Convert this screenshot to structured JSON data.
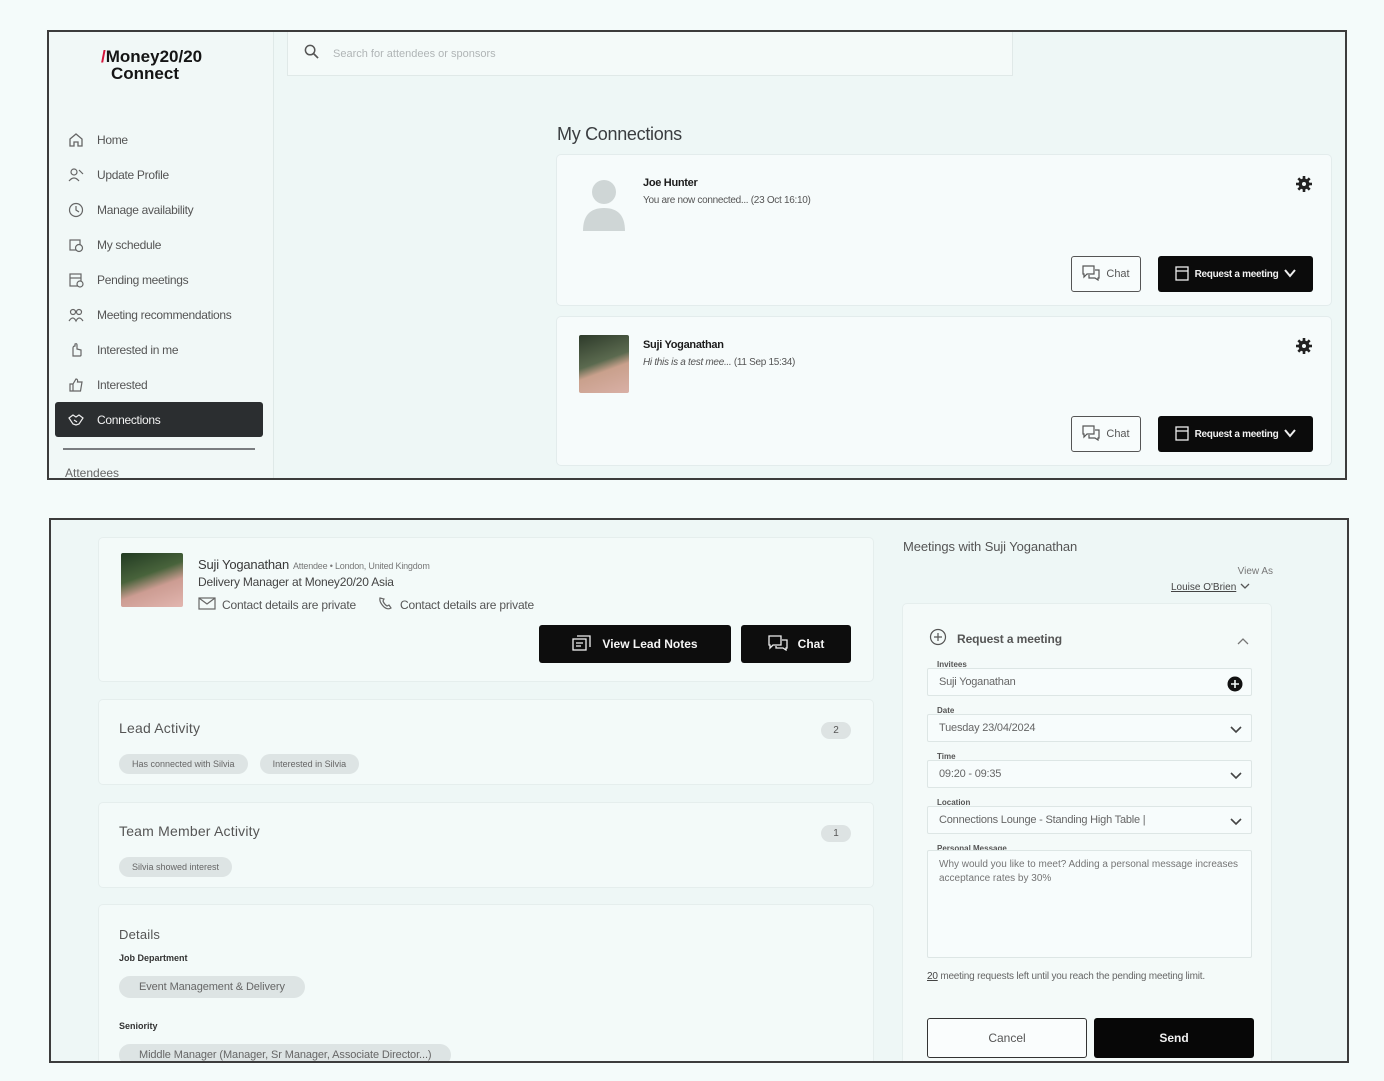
{
  "app": {
    "logo_line1": "Money20/20",
    "logo_line2": "Connect"
  },
  "search": {
    "placeholder": "Search for attendees or sponsors"
  },
  "sidebar": {
    "items": [
      {
        "label": "Home",
        "icon": "home-icon"
      },
      {
        "label": "Update Profile",
        "icon": "update-profile-icon"
      },
      {
        "label": "Manage availability",
        "icon": "clock-icon"
      },
      {
        "label": "My schedule",
        "icon": "schedule-icon"
      },
      {
        "label": "Pending meetings",
        "icon": "pending-calendar-icon"
      },
      {
        "label": "Meeting recommendations",
        "icon": "people-icon"
      },
      {
        "label": "Interested in me",
        "icon": "hand-icon"
      },
      {
        "label": "Interested",
        "icon": "thumbs-up-icon"
      },
      {
        "label": "Connections",
        "icon": "handshake-icon"
      }
    ],
    "section": "Attendees"
  },
  "connections": {
    "title": "My Connections",
    "items": [
      {
        "name": "Joe Hunter",
        "message": "You are now connected...",
        "time": "(23 Oct 16:10)"
      },
      {
        "name": "Suji Yoganathan",
        "message": "Hi this is a test mee...",
        "time": "(11 Sep 15:34)"
      }
    ],
    "chat_label": "Chat",
    "request_label": "Request a meeting"
  },
  "profile": {
    "name": "Suji Yoganathan",
    "meta": "Attendee • London, United Kingdom",
    "role": "Delivery Manager at Money20/20 Asia",
    "contact_email": "Contact details are private",
    "contact_phone": "Contact details are private",
    "view_notes_label": "View Lead Notes",
    "chat_label": "Chat"
  },
  "lead_activity": {
    "title": "Lead Activity",
    "count": "2",
    "tags": [
      "Has connected with Silvia",
      "Interested in Silvia"
    ]
  },
  "team_activity": {
    "title": "Team Member Activity",
    "count": "1",
    "tags": [
      "Silvia showed interest"
    ]
  },
  "details": {
    "title": "Details",
    "job_department_label": "Job Department",
    "job_department": "Event Management & Delivery",
    "seniority_label": "Seniority",
    "seniority": "Middle Manager (Manager, Sr Manager, Associate Director...)"
  },
  "meeting": {
    "title": "Meetings with Suji Yoganathan",
    "view_as_label": "View As",
    "view_as_user": "Louise O'Brien",
    "request_label": "Request a meeting",
    "invitees_label": "Invitees",
    "invitees_value": "Suji Yoganathan",
    "date_label": "Date",
    "date_value": "Tuesday 23/04/2024",
    "time_label": "Time",
    "time_value": "09:20 - 09:35",
    "location_label": "Location",
    "location_value": "Connections Lounge - Standing High Table |",
    "message_label": "Personal Message",
    "message_placeholder": "Why would you like to meet? Adding a personal message increases acceptance rates by 30%",
    "limit_count": "20",
    "limit_text": " meeting requests left until you reach the pending meeting limit.",
    "cancel_label": "Cancel",
    "send_label": "Send"
  },
  "colors": {
    "brand_red": "#d4143a",
    "dark": "#0b0b0b",
    "background": "#eef7f6"
  }
}
